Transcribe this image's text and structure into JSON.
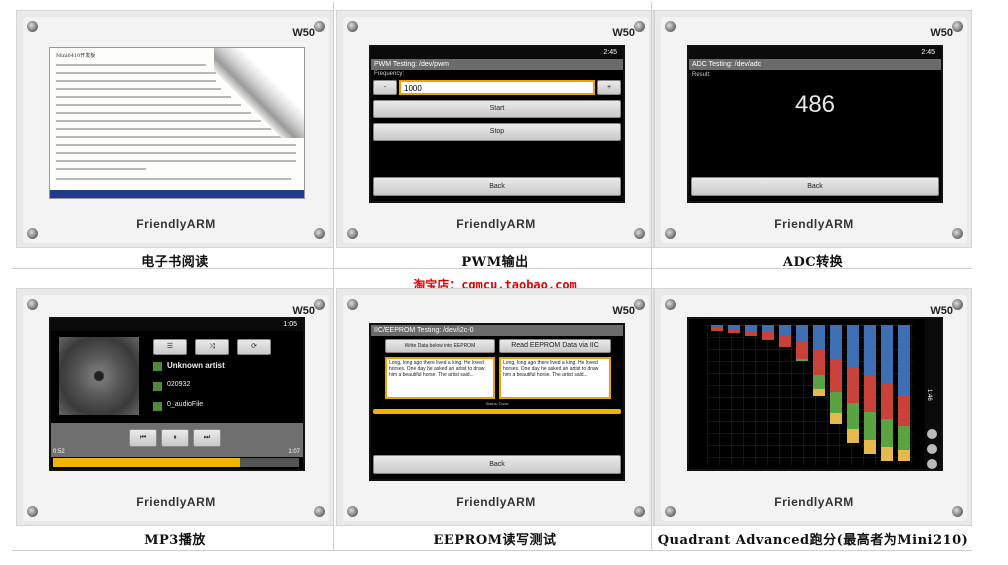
{
  "board": {
    "model": "W50",
    "brand": "FriendlyARM"
  },
  "captions": {
    "ebook": "电子书阅读",
    "pwm": "PWM输出",
    "adc": "ADC转换",
    "mp3": "MP3播放",
    "eeprom": "EEPROM读写测试",
    "quadrant": "Quadrant Advanced跑分(最高者为Mini210)"
  },
  "watermark": "淘宝店：cqmcu.taobao.com",
  "screens": {
    "ebook": {
      "title": "Mini6410开发板"
    },
    "pwm": {
      "status_time": "2:45",
      "title": "PWM Testing: /dev/pwm",
      "frequency_label": "Frequency:",
      "minus_label": "-",
      "plus_label": "+",
      "value": "1000",
      "start_label": "Start",
      "stop_label": "Stop",
      "back_label": "Back"
    },
    "adc": {
      "status_time": "2:45",
      "title": "ADC Testing: /dev/adc",
      "result_label": "Result:",
      "value": "486",
      "back_label": "Back"
    },
    "mp3": {
      "status_time": "1:05",
      "artist": "Unknown artist",
      "album": "020932",
      "track": "0_audioFile",
      "elapsed": "0:52",
      "total": "1:07",
      "progress": 0.76
    },
    "eeprom": {
      "title": "IIC/EEPROM Testing: /dev/i2c-0",
      "write_label": "Write Data below into EEPROM",
      "read_label": "Read EEPROM Data via IIC",
      "write_text": "Long, long ago there lived a king. He loved horses. One day he asked an artist to draw him a beautiful horse. The artist said...",
      "read_text": "Long, long ago there lived a king. He loved horses. One day he asked an artist to draw him a beautiful horse. The artist said...",
      "status": "Status: Done",
      "back_label": "Back"
    },
    "quadrant": {
      "status_time": "1:46",
      "bars": [
        {
          "label": "",
          "blue": 0.02,
          "red": 0.02,
          "green": 0.0,
          "yellow": 0.0
        },
        {
          "label": "",
          "blue": 0.03,
          "red": 0.03,
          "green": 0.0,
          "yellow": 0.0
        },
        {
          "label": "",
          "blue": 0.04,
          "red": 0.04,
          "green": 0.0,
          "yellow": 0.0
        },
        {
          "label": "",
          "blue": 0.05,
          "red": 0.06,
          "green": 0.0,
          "yellow": 0.0
        },
        {
          "label": "",
          "blue": 0.08,
          "red": 0.08,
          "green": 0.0,
          "yellow": 0.0
        },
        {
          "label": "",
          "blue": 0.12,
          "red": 0.12,
          "green": 0.02,
          "yellow": 0.0
        },
        {
          "label": "",
          "blue": 0.18,
          "red": 0.18,
          "green": 0.1,
          "yellow": 0.05
        },
        {
          "label": "",
          "blue": 0.24,
          "red": 0.24,
          "green": 0.15,
          "yellow": 0.08
        },
        {
          "label": "",
          "blue": 0.3,
          "red": 0.26,
          "green": 0.18,
          "yellow": 0.1
        },
        {
          "label": "",
          "blue": 0.36,
          "red": 0.26,
          "green": 0.2,
          "yellow": 0.1
        },
        {
          "label": "",
          "blue": 0.42,
          "red": 0.25,
          "green": 0.2,
          "yellow": 0.1
        },
        {
          "label": "",
          "blue": 0.5,
          "red": 0.22,
          "green": 0.17,
          "yellow": 0.08
        }
      ]
    }
  },
  "colors": {
    "accent": "#f0a300",
    "watermark": "#e00000",
    "q_blue": "#3f6fb3",
    "q_red": "#c8413b",
    "q_green": "#5aa342",
    "q_yellow": "#e6b94c"
  }
}
